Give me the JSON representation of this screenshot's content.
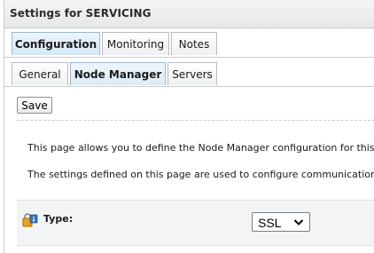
{
  "window": {
    "title": "Settings for SERVICING"
  },
  "primary_tabs": [
    {
      "label": "Configuration",
      "active": true
    },
    {
      "label": "Monitoring",
      "active": false
    },
    {
      "label": "Notes",
      "active": false
    }
  ],
  "secondary_tabs": [
    {
      "label": "General",
      "active": false
    },
    {
      "label": "Node Manager",
      "active": true
    },
    {
      "label": "Servers",
      "active": false
    }
  ],
  "toolbar": {
    "save_label": "Save"
  },
  "description": {
    "line1": "This page allows you to define the Node Manager configuration for this",
    "line2": "The settings defined on this page are used to configure communication"
  },
  "fields": {
    "type": {
      "label": "Type:",
      "value": "SSL",
      "icon": "info-lock-icon"
    }
  },
  "colors": {
    "active_tab": "#d6e8f5",
    "border": "#c9ccd0",
    "panel": "#f3f4f5"
  }
}
